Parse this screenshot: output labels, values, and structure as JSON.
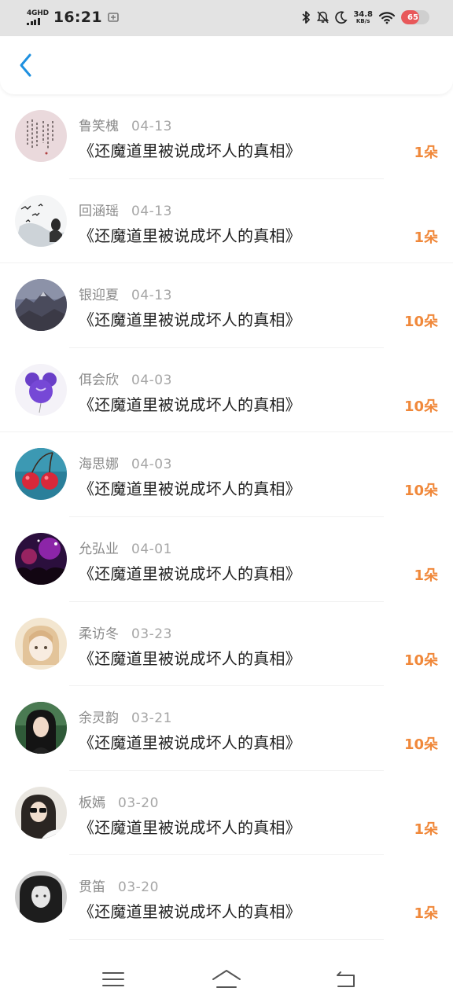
{
  "status_bar": {
    "network_type": "4GHD",
    "time": "16:21",
    "speed_value": "34.8",
    "speed_unit": "KB/s",
    "battery_percent": "65",
    "battery_level": 0.65,
    "battery_color": "#e8585a",
    "icons": [
      "signal-icon",
      "screenshot-icon",
      "bluetooth-icon",
      "mute-icon",
      "moon-icon",
      "wifi-icon",
      "battery-icon"
    ]
  },
  "header": {
    "back_icon": "chevron-left-icon",
    "accent": "#1e90e0"
  },
  "list": {
    "accent_gift": "#f0883a",
    "items": [
      {
        "name": "鲁笑槐",
        "date": "04-13",
        "title": "《还魔道里被说成坏人的真相》",
        "gift": "1朵",
        "avatar": "calligraphy-avatar"
      },
      {
        "name": "回涵瑶",
        "date": "04-13",
        "title": "《还魔道里被说成坏人的真相》",
        "gift": "1朵",
        "avatar": "birds-girl-avatar"
      },
      {
        "name": "银迎夏",
        "date": "04-13",
        "title": "《还魔道里被说成坏人的真相》",
        "gift": "10朵",
        "avatar": "mountain-avatar"
      },
      {
        "name": "佴会欣",
        "date": "04-03",
        "title": "《还魔道里被说成坏人的真相》",
        "gift": "10朵",
        "avatar": "balloon-avatar"
      },
      {
        "name": "海思娜",
        "date": "04-03",
        "title": "《还魔道里被说成坏人的真相》",
        "gift": "10朵",
        "avatar": "cherries-avatar"
      },
      {
        "name": "允弘业",
        "date": "04-01",
        "title": "《还魔道里被说成坏人的真相》",
        "gift": "1朵",
        "avatar": "concert-avatar"
      },
      {
        "name": "柔访冬",
        "date": "03-23",
        "title": "《还魔道里被说成坏人的真相》",
        "gift": "10朵",
        "avatar": "anime-girl-avatar"
      },
      {
        "name": "余灵韵",
        "date": "03-21",
        "title": "《还魔道里被说成坏人的真相》",
        "gift": "10朵",
        "avatar": "girl-portrait-avatar"
      },
      {
        "name": "板嫣",
        "date": "03-20",
        "title": "《还魔道里被说成坏人的真相》",
        "gift": "1朵",
        "avatar": "sunglasses-girl-avatar"
      },
      {
        "name": "贯笛",
        "date": "03-20",
        "title": "《还魔道里被说成坏人的真相》",
        "gift": "1朵",
        "avatar": "bw-girl-avatar"
      }
    ]
  },
  "nav_bar": {
    "buttons": [
      "menu-icon",
      "home-icon",
      "back-icon"
    ]
  }
}
